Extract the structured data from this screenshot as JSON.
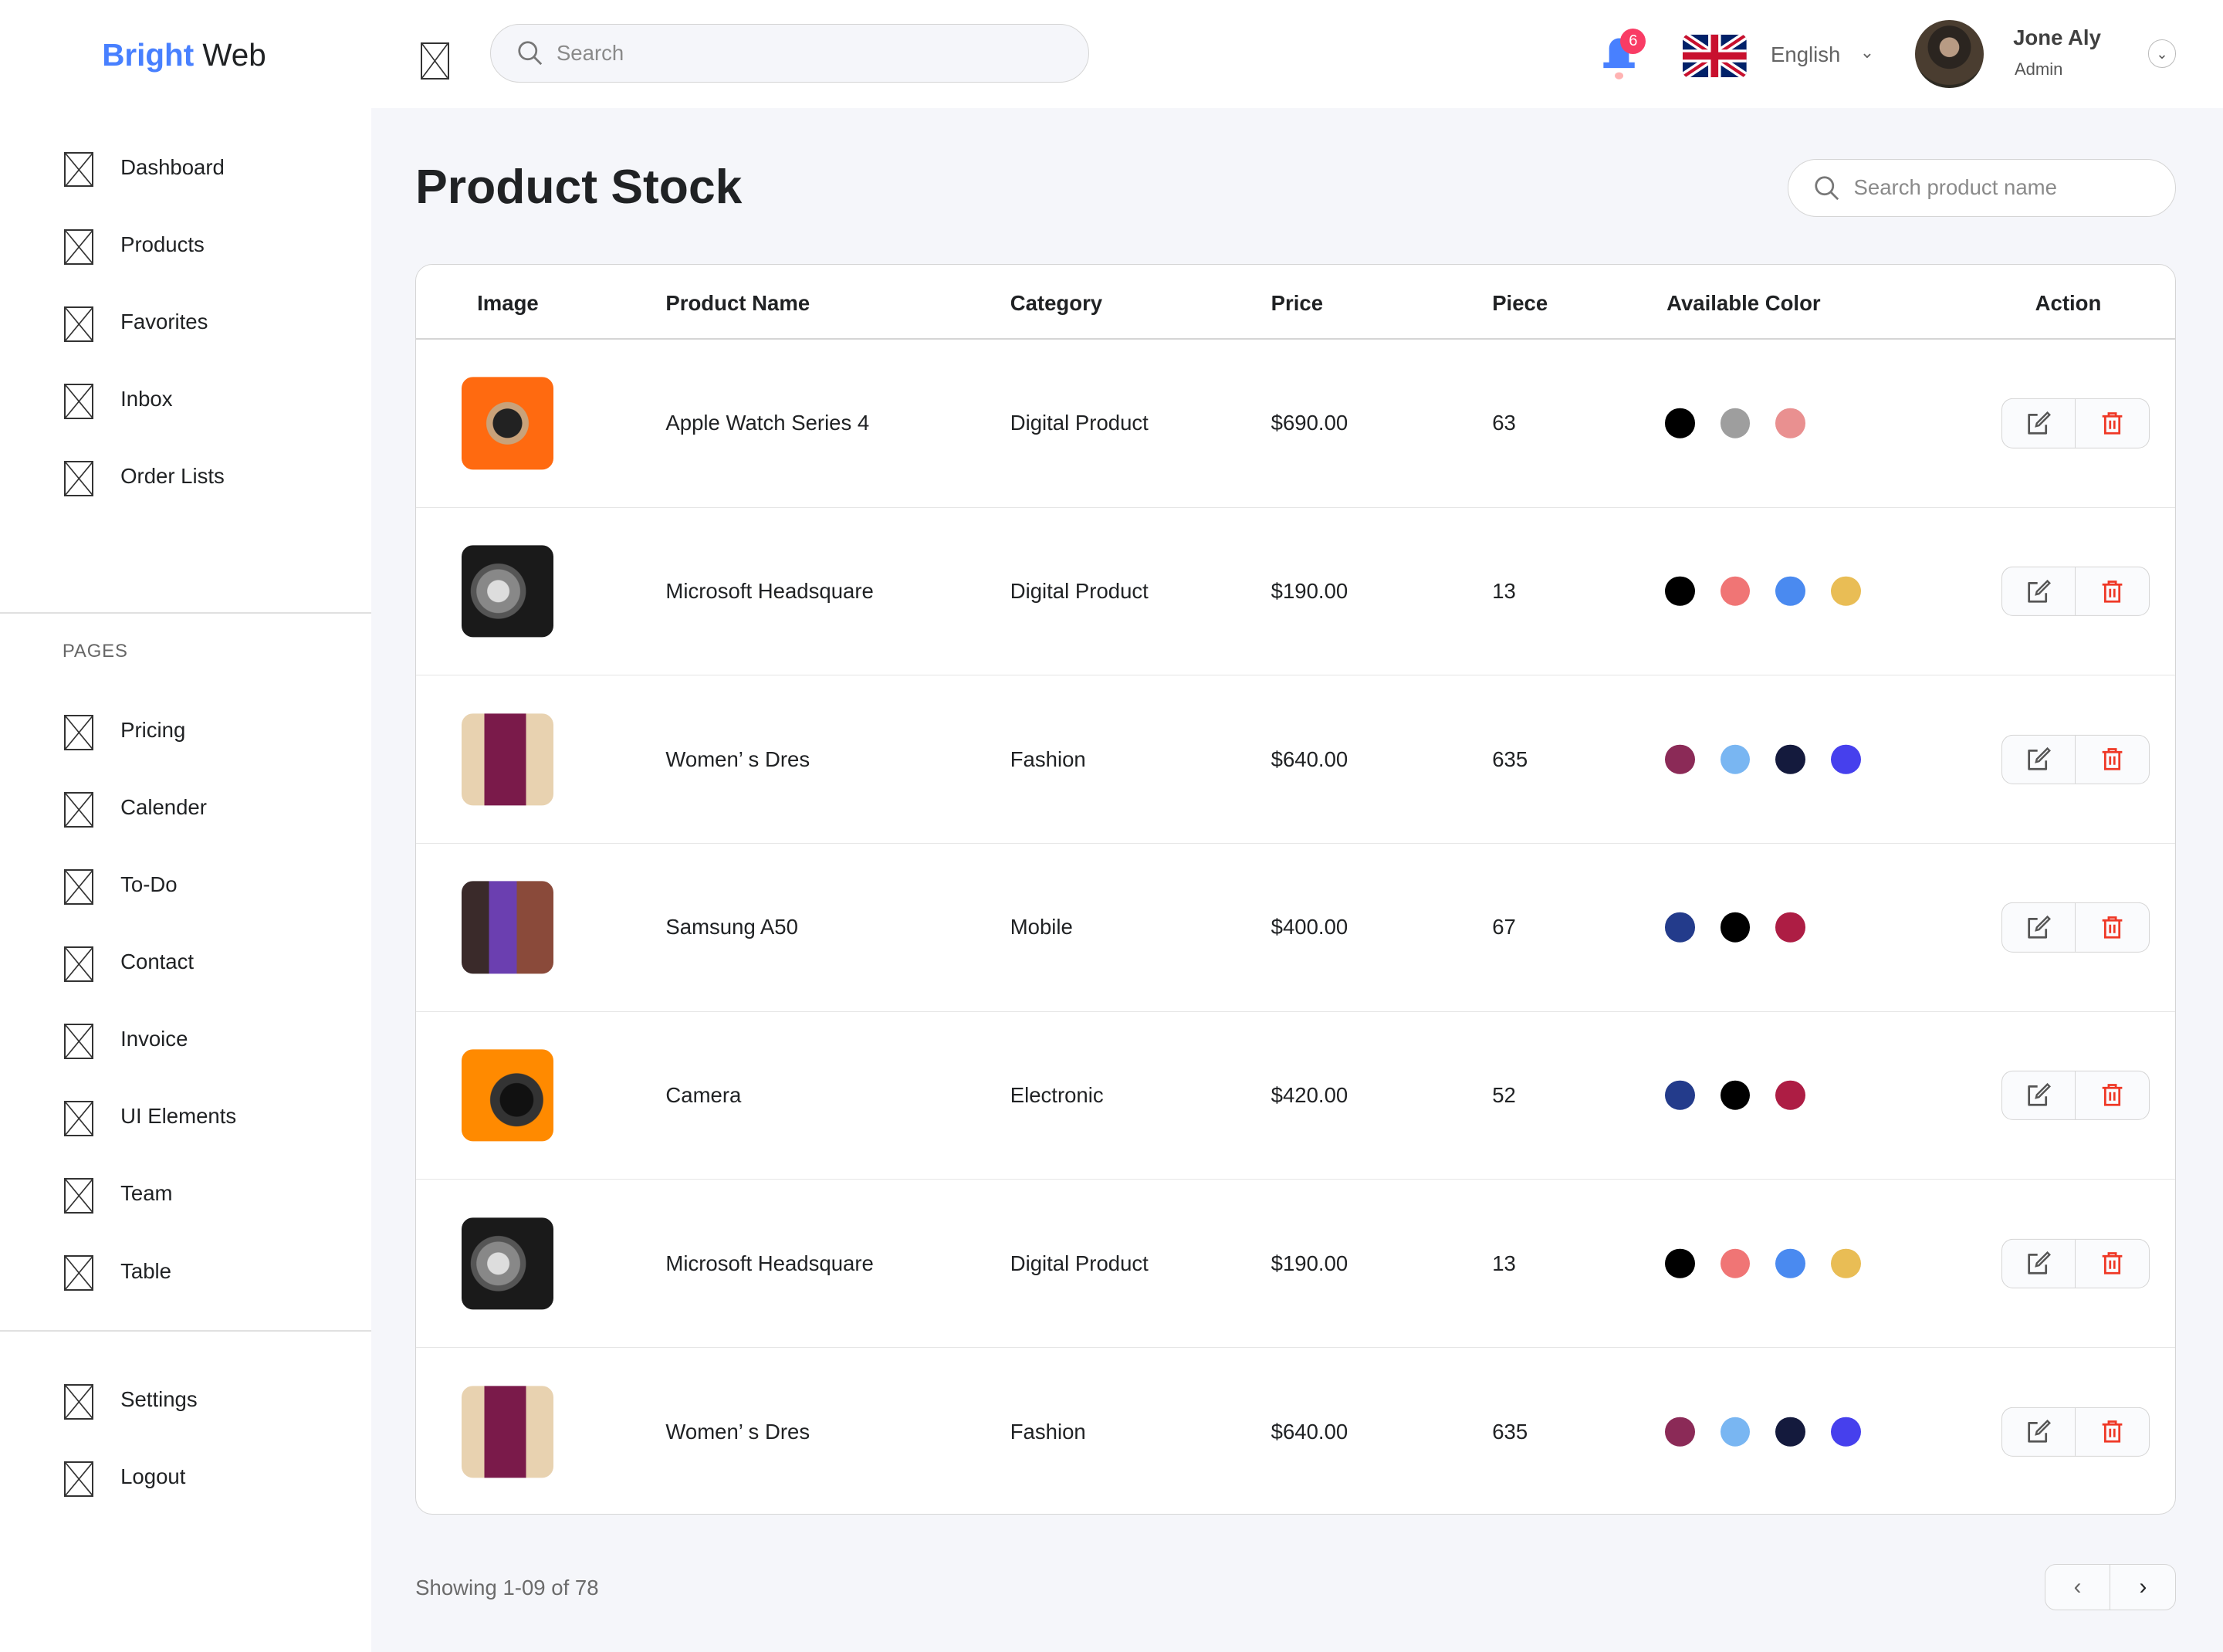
{
  "brand": {
    "part1": "Bright",
    "part2": " Web"
  },
  "header": {
    "search_placeholder": "Search",
    "notifications": "6",
    "language": "English",
    "user_name": "Jone Aly",
    "user_role": "Admin"
  },
  "sidebar": {
    "main": [
      {
        "label": "Dashboard"
      },
      {
        "label": "Products"
      },
      {
        "label": "Favorites"
      },
      {
        "label": "Inbox"
      },
      {
        "label": "Order Lists"
      }
    ],
    "pages_heading": "PAGES",
    "pages": [
      {
        "label": "Pricing"
      },
      {
        "label": "Calender"
      },
      {
        "label": "To-Do"
      },
      {
        "label": "Contact"
      },
      {
        "label": "Invoice"
      },
      {
        "label": "UI Elements"
      },
      {
        "label": "Team"
      },
      {
        "label": "Table"
      }
    ],
    "bottom": [
      {
        "label": "Settings"
      },
      {
        "label": "Logout"
      }
    ]
  },
  "page": {
    "title": "Product Stock",
    "search_placeholder": "Search product name"
  },
  "table": {
    "columns": [
      "Image",
      "Product Name",
      "Category",
      "Price",
      "Piece",
      "Available Color",
      "Action"
    ],
    "rows": [
      {
        "image": "apple-watch",
        "name": "Apple Watch Series 4",
        "category": "Digital Product",
        "price": "$690.00",
        "piece": "63",
        "colors": [
          "#000000",
          "#9e9e9e",
          "#e99090"
        ]
      },
      {
        "image": "headset",
        "name": "Microsoft Headsquare",
        "category": "Digital Product",
        "price": "$190.00",
        "piece": "13",
        "colors": [
          "#000000",
          "#f07575",
          "#4a8af0",
          "#e9bd55"
        ]
      },
      {
        "image": "dress",
        "name": "Women’  s Dres",
        "category": "Fashion",
        "price": "$640.00",
        "piece": "635",
        "colors": [
          "#8b2a57",
          "#79b6f2",
          "#141a3d",
          "#4640ed"
        ]
      },
      {
        "image": "phone",
        "name": "Samsung A50",
        "category": "Mobile",
        "price": "$400.00",
        "piece": "67",
        "colors": [
          "#233b8b",
          "#000000",
          "#ad1d44"
        ]
      },
      {
        "image": "camera",
        "name": "Camera",
        "category": "Electronic",
        "price": "$420.00",
        "piece": "52",
        "colors": [
          "#233b8b",
          "#000000",
          "#ad1d44"
        ]
      },
      {
        "image": "headset",
        "name": "Microsoft Headsquare",
        "category": "Digital Product",
        "price": "$190.00",
        "piece": "13",
        "colors": [
          "#000000",
          "#f07575",
          "#4a8af0",
          "#e9bd55"
        ]
      },
      {
        "image": "dress",
        "name": "Women’  s Dres",
        "category": "Fashion",
        "price": "$640.00",
        "piece": "635",
        "colors": [
          "#8b2a57",
          "#79b6f2",
          "#141a3d",
          "#4640ed"
        ]
      }
    ]
  },
  "footer": {
    "showing": "Showing 1-09 of 78",
    "prev": "‹",
    "next": "›"
  },
  "colors": {
    "accent": "#4880ff",
    "danger": "#ef3826",
    "background": "#f5f6fa"
  }
}
